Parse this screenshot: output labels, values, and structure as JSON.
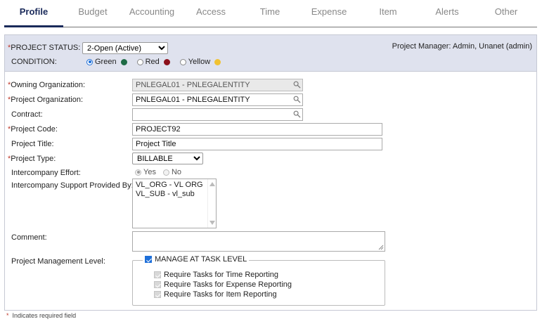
{
  "tabs": [
    {
      "label": "Profile",
      "active": true
    },
    {
      "label": "Budget"
    },
    {
      "label": "Accounting"
    },
    {
      "label": "Access"
    },
    {
      "label": "Time"
    },
    {
      "label": "Expense"
    },
    {
      "label": "Item"
    },
    {
      "label": "Alerts"
    },
    {
      "label": "Other"
    }
  ],
  "required_mark": "*",
  "status": {
    "label": "PROJECT STATUS:",
    "value": "2-Open (Active)",
    "condition_label": "CONDITION:",
    "conditions": [
      {
        "label": "Green",
        "color": "#1e6b45",
        "checked": true
      },
      {
        "label": "Red",
        "color": "#8b0f1a",
        "checked": false
      },
      {
        "label": "Yellow",
        "color": "#f1c232",
        "checked": false
      }
    ],
    "project_manager": "Project Manager: Admin, Unanet (admin)"
  },
  "form": {
    "owning_org": {
      "label": "Owning Organization:",
      "value": "PNLEGAL01 - PNLEGALENTITY"
    },
    "project_org": {
      "label": "Project Organization:",
      "value": "PNLEGAL01 - PNLEGALENTITY"
    },
    "contract": {
      "label": "Contract:",
      "value": ""
    },
    "project_code": {
      "label": "Project Code:",
      "value": "PROJECT92"
    },
    "project_title": {
      "label": "Project Title:",
      "value": "Project Title"
    },
    "project_type": {
      "label": "Project Type:",
      "value": "BILLABLE"
    },
    "intercompany_effort": {
      "label": "Intercompany Effort:",
      "yes": "Yes",
      "no": "No"
    },
    "intercompany_support": {
      "label": "Intercompany Support Provided By:",
      "options": [
        "VL_ORG - VL ORG",
        "VL_SUB - vl_sub"
      ]
    },
    "comment": {
      "label": "Comment:"
    },
    "mgmt_level": {
      "label": "Project Management Level:",
      "manage_at_task": "MANAGE AT TASK LEVEL",
      "req_time": "Require Tasks for Time Reporting",
      "req_expense": "Require Tasks for Expense Reporting",
      "req_item": "Require Tasks for Item Reporting"
    }
  },
  "footnote": "Indicates required field",
  "colors": {
    "accent": "#1e6fd9",
    "tab_active": "#1a2a5a",
    "status_bg": "#dfe2ee",
    "required": "#c0392b"
  }
}
